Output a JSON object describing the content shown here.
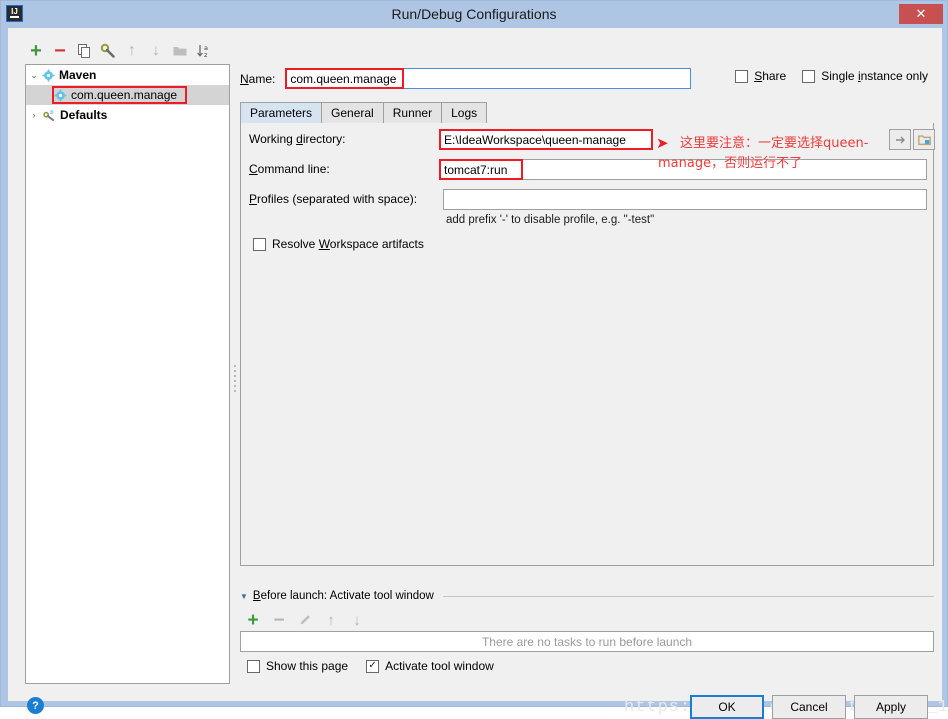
{
  "window": {
    "title": "Run/Debug Configurations",
    "app_icon": "intellij-idea-icon",
    "icon_letters": "IJ",
    "close_label": "✕",
    "titlebar_color": "#aec6e4",
    "close_color": "#c75050"
  },
  "left_toolbar": {
    "items": [
      {
        "name": "add-configuration-button",
        "glyph": "+",
        "color": "#3c9a3c",
        "enabled": true
      },
      {
        "name": "remove-configuration-button",
        "glyph": "−",
        "color": "#cc3a3a",
        "enabled": true
      },
      {
        "name": "copy-configuration-button",
        "glyph": "copy-icon",
        "color": "#6b6b6b",
        "enabled": true
      },
      {
        "name": "edit-templates-button",
        "glyph": "wrench-icon",
        "color": "#7a7a3a",
        "enabled": true
      },
      {
        "name": "move-up-button",
        "glyph": "↑",
        "color": "#b4b4b4",
        "enabled": false
      },
      {
        "name": "move-down-button",
        "glyph": "↓",
        "color": "#b4b4b4",
        "enabled": false
      },
      {
        "name": "create-folder-button",
        "glyph": "folder-icon",
        "color": "#b4b4b4",
        "enabled": false
      },
      {
        "name": "sort-alphabetically-button",
        "glyph": "sort-az-icon",
        "color": "#6b6b6b",
        "enabled": true
      }
    ]
  },
  "tree": {
    "nodes": [
      {
        "label": "Maven",
        "icon": "maven-gear-icon",
        "expanded": true,
        "arrow": "⌄",
        "level": 0,
        "selected": false,
        "bold": true
      },
      {
        "label": "com.queen.manage",
        "icon": "maven-gear-icon",
        "expanded": null,
        "arrow": "",
        "level": 1,
        "selected": true,
        "bold": false,
        "highlighted": true
      },
      {
        "label": "Defaults",
        "icon": "defaults-wrench-icon",
        "expanded": false,
        "arrow": "›",
        "level": 0,
        "selected": false,
        "bold": true
      }
    ]
  },
  "name_field": {
    "label": "Name:",
    "label_mnemonic": "N",
    "value": "com.queen.manage",
    "highlighted": true
  },
  "options": [
    {
      "label": "Share",
      "mnemonic": "S",
      "checked": false,
      "name": "share-checkbox"
    },
    {
      "label": "Single instance only",
      "mnemonic": "i",
      "checked": false,
      "name": "single-instance-only-checkbox"
    }
  ],
  "tabs": [
    {
      "label": "Parameters",
      "active": true
    },
    {
      "label": "General",
      "active": false
    },
    {
      "label": "Runner",
      "active": false
    },
    {
      "label": "Logs",
      "active": false
    }
  ],
  "parameters": {
    "working_directory": {
      "label": "Working directory:",
      "label_pre": "Working ",
      "label_mnemonic": "d",
      "label_post": "irectory:",
      "value": "E:\\IdeaWorkspace\\queen-manage",
      "highlighted": true,
      "expand_button": "expand-macros-button",
      "browse_button": "browse-folder-button"
    },
    "command_line": {
      "label": "Command line:",
      "label_mnemonic": "C",
      "label_post": "ommand line:",
      "value": "tomcat7:run",
      "highlighted": true
    },
    "profiles": {
      "label": "Profiles (separated with space):",
      "label_mnemonic": "P",
      "label_post": "rofiles (separated with space):",
      "value": "",
      "hint": "add prefix '-' to disable profile, e.g. \"-test\""
    },
    "resolve_workspace_artifacts": {
      "label_pre": "Resolve ",
      "label_mnemonic": "W",
      "label_post": "orkspace artifacts",
      "checked": false
    }
  },
  "annotation": {
    "arrow": "➤",
    "line1": "这里要注意：一定要选择queen-",
    "line2": "manage，否则运行不了",
    "color": "#ee3b3b"
  },
  "before_launch": {
    "triangle": "▼",
    "title": "Before launch: Activate tool window",
    "title_mnemonic": "B",
    "title_post": "efore launch: Activate tool window",
    "toolbar": [
      {
        "name": "add-task-button",
        "glyph": "+",
        "color": "#3c9a3c",
        "enabled": true
      },
      {
        "name": "remove-task-button",
        "glyph": "−",
        "color": "#b4b4b4",
        "enabled": false
      },
      {
        "name": "edit-task-button",
        "glyph": "pencil-icon",
        "color": "#b4b4b4",
        "enabled": false
      },
      {
        "name": "move-task-up-button",
        "glyph": "↑",
        "color": "#b4b4b4",
        "enabled": false
      },
      {
        "name": "move-task-down-button",
        "glyph": "↓",
        "color": "#b4b4b4",
        "enabled": false
      }
    ],
    "empty_text": "There are no tasks to run before launch",
    "checkboxes": [
      {
        "label": "Show this page",
        "checked": false,
        "name": "show-this-page-checkbox"
      },
      {
        "label": "Activate tool window",
        "checked": true,
        "name": "activate-tool-window-checkbox"
      }
    ]
  },
  "footer": {
    "help_glyph": "?",
    "buttons": [
      {
        "label": "OK",
        "name": "ok-button",
        "default": true
      },
      {
        "label": "Cancel",
        "name": "cancel-button",
        "default": false
      },
      {
        "label": "Apply",
        "name": "apply-button",
        "default": false
      }
    ]
  },
  "watermark": {
    "text": "https://blog.csdn.net/Gaohm_1990"
  }
}
